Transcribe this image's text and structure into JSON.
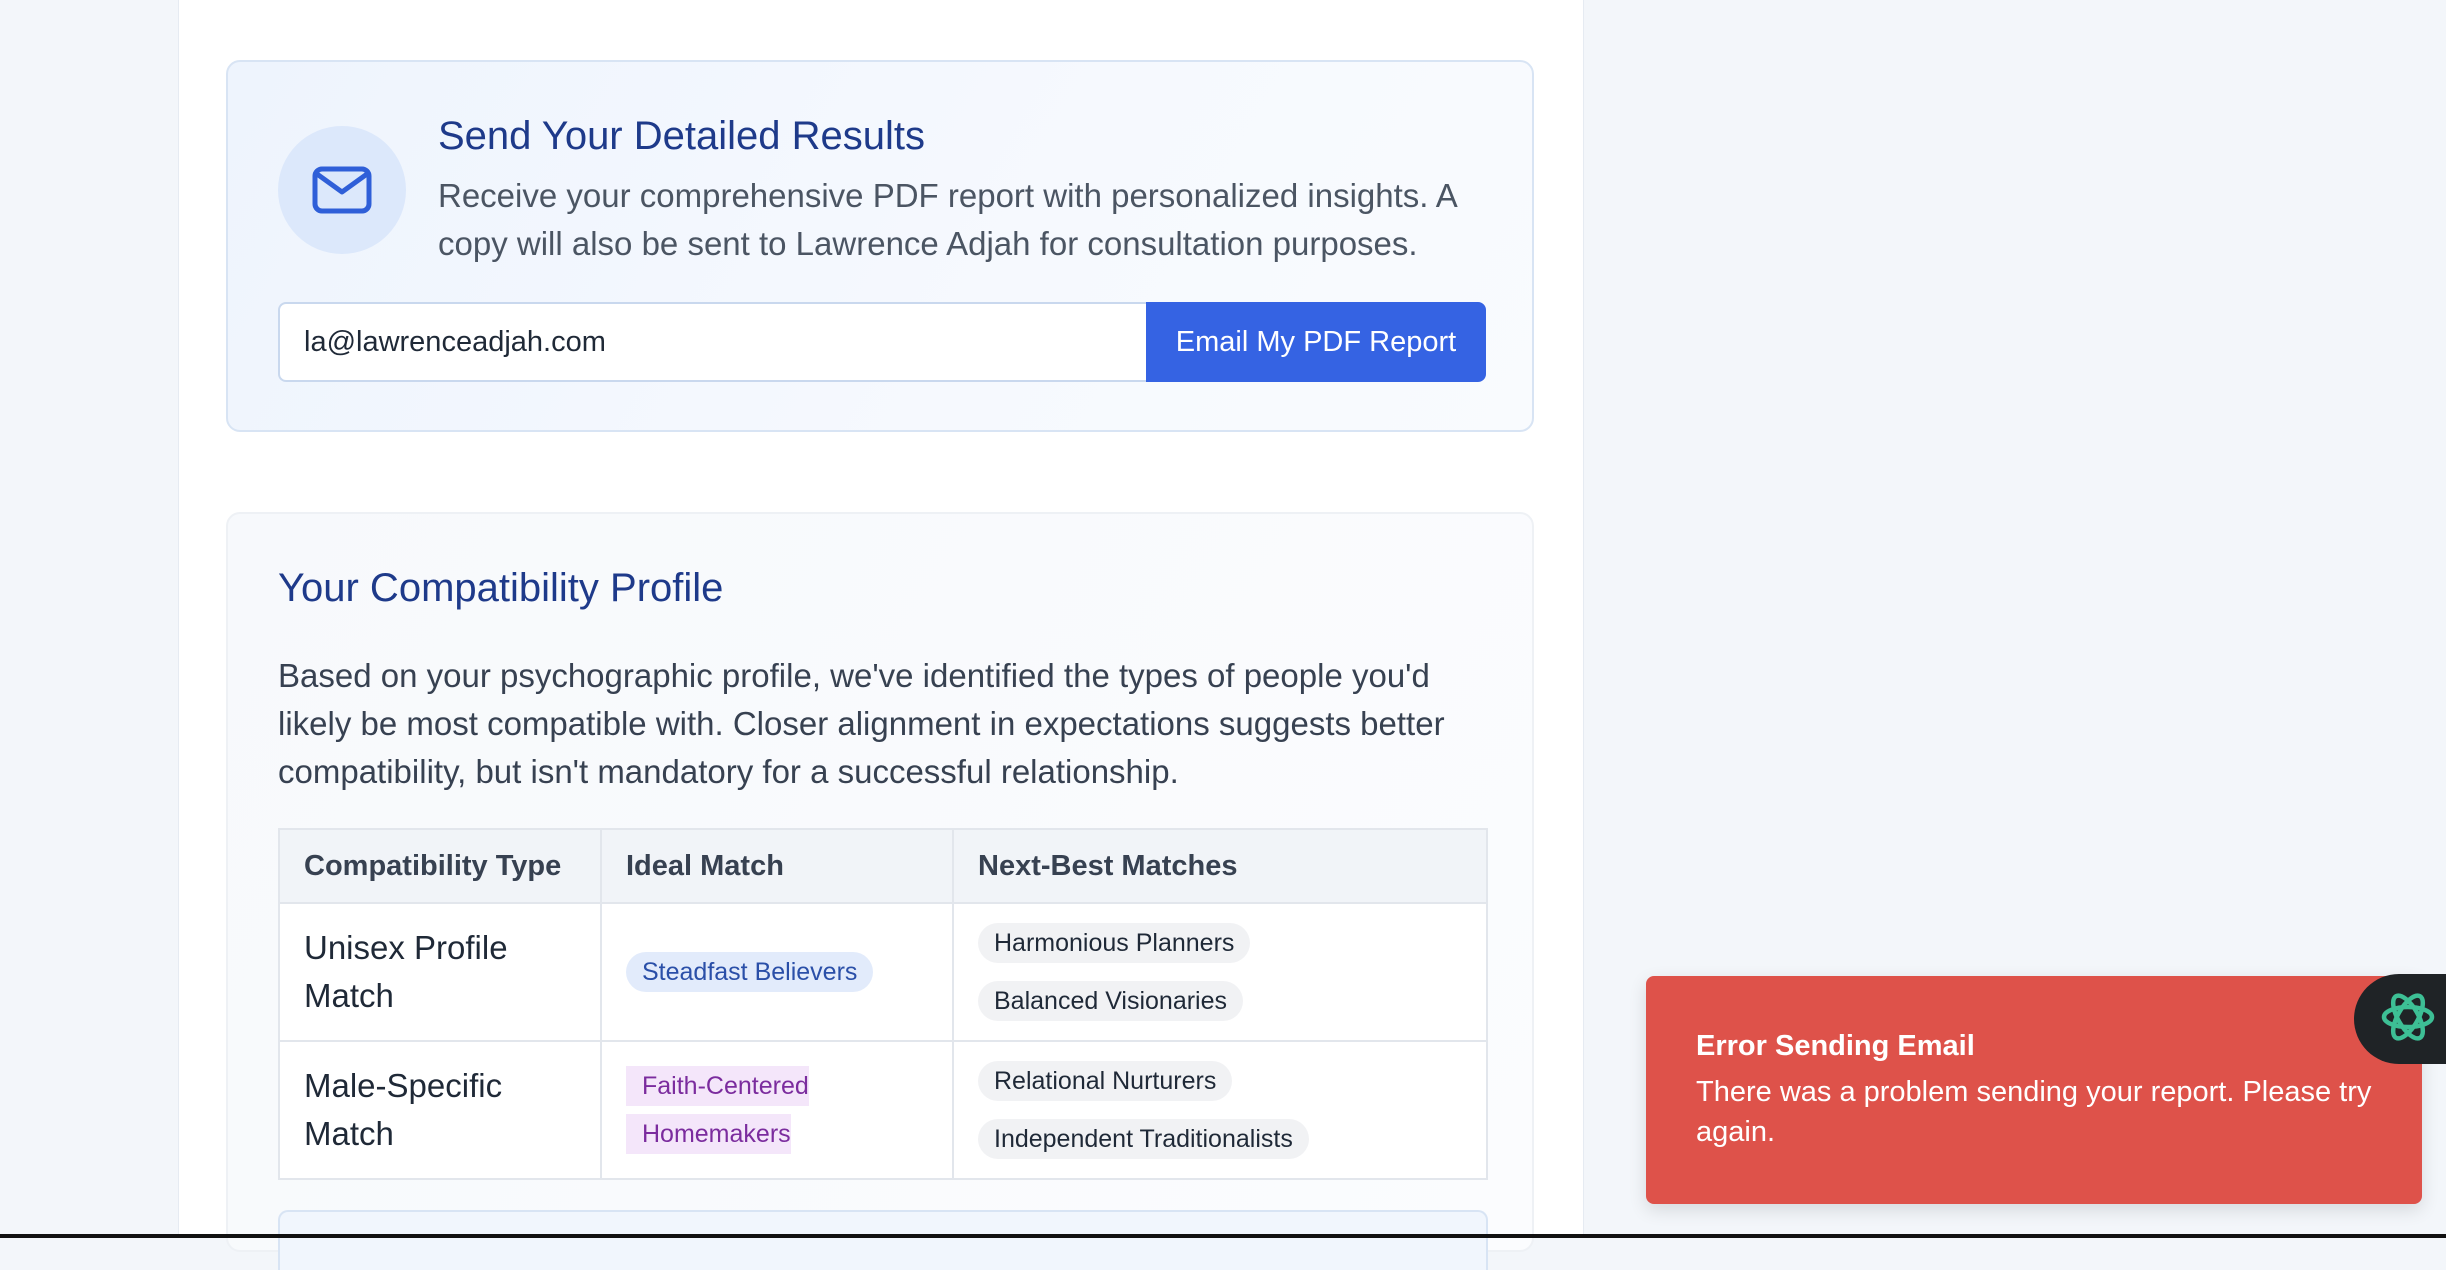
{
  "email_section": {
    "title": "Send Your Detailed Results",
    "description": "Receive your comprehensive PDF report with personalized insights. A copy will also be sent to Lawrence Adjah for consultation purposes.",
    "email_value": "la@lawrenceadjah.com",
    "button_label": "Email My PDF Report",
    "icon": "mail-icon"
  },
  "compatibility": {
    "title": "Your Compatibility Profile",
    "description": "Based on your psychographic profile, we've identified the types of people you'd likely be most compatible with. Closer alignment in expectations suggests better compatibility, but isn't mandatory for a successful relationship.",
    "table": {
      "headers": [
        "Compatibility Type",
        "Ideal Match",
        "Next-Best Matches"
      ],
      "rows": [
        {
          "type": "Unisex Profile Match",
          "ideal": "Steadfast Believers",
          "next": [
            "Harmonious Planners",
            "Balanced Visionaries"
          ]
        },
        {
          "type": "Male-Specific Match",
          "ideal": "Faith-Centered Homemakers",
          "next": [
            "Relational Nurturers",
            "Independent Traditionalists"
          ]
        }
      ]
    }
  },
  "toast": {
    "title": "Error Sending Email",
    "message": "There was a problem sending your report. Please try again.",
    "color": "#de524a"
  },
  "assistant_button": {
    "icon": "assistant-logo-icon"
  },
  "colors": {
    "accent": "#3563e3",
    "heading": "#1e3a8a",
    "ideal_chip_blue": "#e2ebfb",
    "ideal_chip_purple": "#f4e6fa"
  }
}
